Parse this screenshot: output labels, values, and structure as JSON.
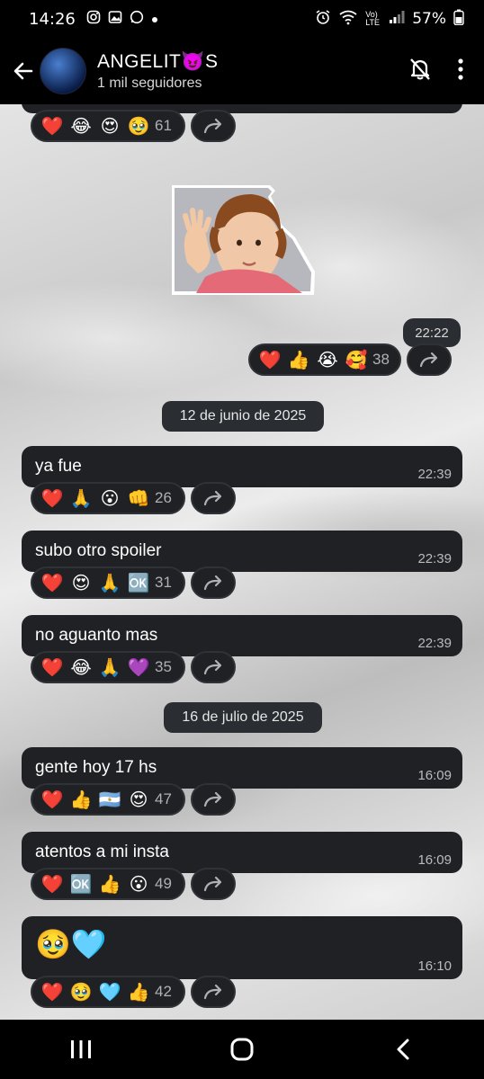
{
  "status_bar": {
    "time": "14:26",
    "battery": "57%",
    "network": "Vo) LTE"
  },
  "header": {
    "channel_name": "ANGELIT😈S",
    "subtitle": "1 mil seguidores"
  },
  "top_partial": {
    "reactions": [
      "❤️",
      "😂",
      "😍",
      "🥹"
    ],
    "count": "61"
  },
  "sticker_message": {
    "time": "22:22",
    "reactions": [
      "❤️",
      "👍",
      "😭",
      "🥰"
    ],
    "count": "38"
  },
  "date_separators": [
    "12 de junio de 2025",
    "16 de julio de 2025"
  ],
  "messages": [
    {
      "text": "ya fue",
      "time": "22:39",
      "reactions": [
        "❤️",
        "🙏",
        "😮",
        "👊"
      ],
      "count": "26"
    },
    {
      "text": "subo otro spoiler",
      "time": "22:39",
      "reactions": [
        "❤️",
        "😍",
        "🙏",
        "🆗"
      ],
      "count": "31"
    },
    {
      "text": "no aguanto mas",
      "time": "22:39",
      "reactions": [
        "❤️",
        "😂",
        "🙏",
        "💜"
      ],
      "count": "35"
    },
    {
      "text": "gente hoy 17 hs",
      "time": "16:09",
      "reactions": [
        "❤️",
        "👍",
        "🇦🇷",
        "😍"
      ],
      "count": "47"
    },
    {
      "text": "atentos a mi insta",
      "time": "16:09",
      "reactions": [
        "❤️",
        "🆗",
        "👍",
        "😮"
      ],
      "count": "49"
    },
    {
      "text": "🥹🩵",
      "time": "16:10",
      "reactions": [
        "❤️",
        "🥹",
        "🩵",
        "👍"
      ],
      "count": "42"
    }
  ],
  "colors": {
    "bubble": "#1f2124",
    "chip": "#2a2d31",
    "background_silk": "#d9d9d9"
  },
  "icons": {
    "back": "arrow-left-icon",
    "mute": "bell-off-icon",
    "menu": "more-vertical-icon",
    "forward": "forward-arrow-icon",
    "nav_recent": "recent-apps-icon",
    "nav_home": "home-icon",
    "nav_back": "nav-back-icon"
  }
}
